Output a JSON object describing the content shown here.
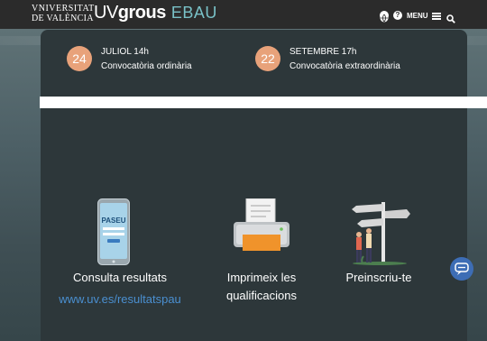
{
  "header": {
    "uv_logo_line1": "VNIVERSITAT",
    "uv_logo_line2": "DE VALÈNCIA",
    "brand_uv": "UV",
    "brand_grous": "grous",
    "brand_ebau": "EBAU",
    "menu_label": "MENU",
    "icons": [
      "globe-icon",
      "help-icon",
      "hamburger-icon",
      "search-icon"
    ]
  },
  "calls": [
    {
      "day": "24",
      "title": "JULIOL 14h",
      "subtitle": "Convocatòria ordinària"
    },
    {
      "day": "22",
      "title": "SETEMBRE 17h",
      "subtitle": "Convocatòria extraordinària"
    }
  ],
  "tiles": [
    {
      "label": "Consulta resultats",
      "link": "www.uv.es/resultatspau",
      "icon": "phone-paseu-icon",
      "phone_text": "PASEU"
    },
    {
      "label_line1": "Imprimeix les",
      "label_line2": "qualificacions",
      "icon": "printer-icon"
    },
    {
      "label": "Preinscriu-te",
      "icon": "signpost-icon"
    }
  ],
  "colors": {
    "accent_badge": "#e8a27a",
    "ebau": "#79c1c7",
    "link": "#4a8fd0",
    "panel": "#2d373a",
    "chat": "#3d6db5"
  },
  "chat": {
    "icon": "chat-icon"
  }
}
